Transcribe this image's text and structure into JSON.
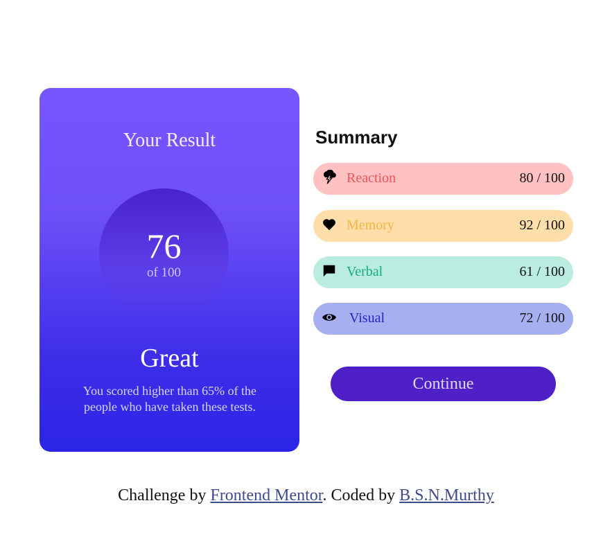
{
  "result": {
    "title": "Your Result",
    "score": "76",
    "out_of": "of 100",
    "rating": "Great",
    "description": "You scored higher than 65% of the people who have taken these tests."
  },
  "summary": {
    "title": "Summary",
    "items": [
      {
        "label": "Reaction",
        "score": "80 / 100",
        "icon": "lightning-icon",
        "color": "#f05258",
        "bg": "#ffc1c1"
      },
      {
        "label": "Memory",
        "score": "92 / 100",
        "icon": "heart-icon",
        "color": "#f5b443",
        "bg": "#ffdea9"
      },
      {
        "label": "Verbal",
        "score": "61 / 100",
        "icon": "speech-bubble-icon",
        "color": "#15aa87",
        "bg": "#baede0"
      },
      {
        "label": "Visual",
        "score": "72 / 100",
        "icon": "eye-icon",
        "color": "#2424c4",
        "bg": "#a6aff0"
      }
    ],
    "continue_label": "Continue"
  },
  "footer": {
    "prefix": "Challenge by ",
    "link1": "Frontend Mentor",
    "middle": ". Coded by ",
    "link2": "B.S.N.Murthy"
  },
  "colors": {
    "accent": "#4f1fc8",
    "card_gradient_top": "#7755ff",
    "card_gradient_bottom": "#2c25e6"
  }
}
